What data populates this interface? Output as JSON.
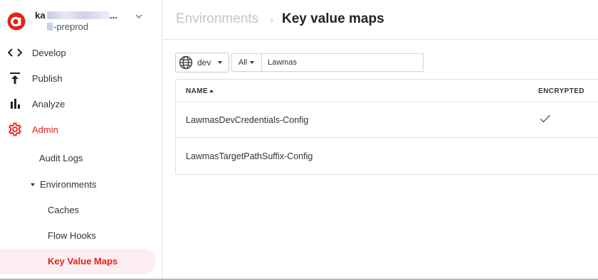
{
  "org": {
    "name_prefix": "ka",
    "name_suffix": "...",
    "env_suffix": "-preprod"
  },
  "sidebar": {
    "items": [
      {
        "label": "Develop",
        "icon": "code-icon"
      },
      {
        "label": "Publish",
        "icon": "upload-icon"
      },
      {
        "label": "Analyze",
        "icon": "bar-chart-icon"
      },
      {
        "label": "Admin",
        "icon": "gear-icon"
      }
    ],
    "admin_sub": {
      "audit_logs": "Audit Logs",
      "environments": "Environments",
      "caches": "Caches",
      "flow_hooks": "Flow Hooks",
      "key_value_maps": "Key Value Maps"
    }
  },
  "header": {
    "breadcrumb": "Environments",
    "separator": "›",
    "title": "Key value maps"
  },
  "filters": {
    "environment": "dev",
    "type": "All",
    "search_value": "Lawmas"
  },
  "table": {
    "columns": [
      "NAME",
      "ENCRYPTED"
    ],
    "rows": [
      {
        "name": "LawmasDevCredentials-Config",
        "encrypted": true
      },
      {
        "name": "LawmasTargetPathSuffix-Config",
        "encrypted": false
      }
    ]
  },
  "colors": {
    "accent": "#e2241b",
    "active_bg": "#fdeef1"
  }
}
